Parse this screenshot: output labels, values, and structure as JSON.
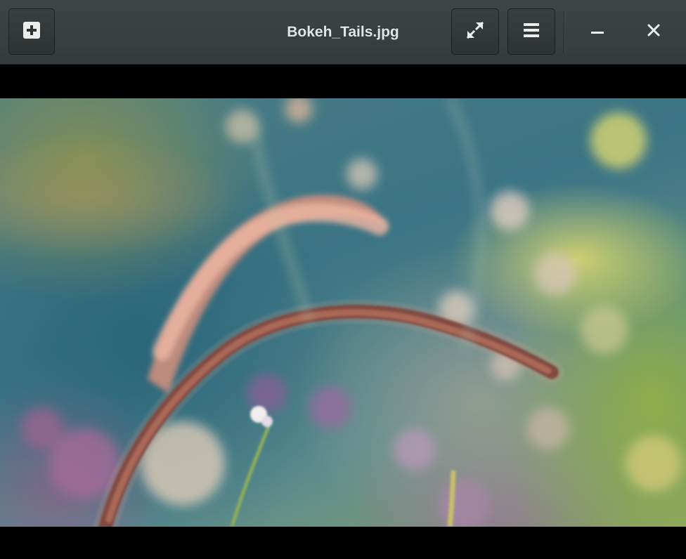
{
  "window": {
    "title": "Bokeh_Tails.jpg"
  },
  "headerbar": {
    "left_button_icon": "plus-icon",
    "right_buttons": [
      {
        "icon": "fullscreen-icon"
      },
      {
        "icon": "menu-icon"
      }
    ],
    "window_controls": [
      {
        "icon": "minimize-icon"
      },
      {
        "icon": "close-icon"
      }
    ]
  },
  "viewer": {
    "image_description_icon": "image-icon"
  },
  "colors": {
    "headerbar_bg": "#3a4041",
    "title_text": "#e4e6e6",
    "viewport_bg": "#000000"
  }
}
